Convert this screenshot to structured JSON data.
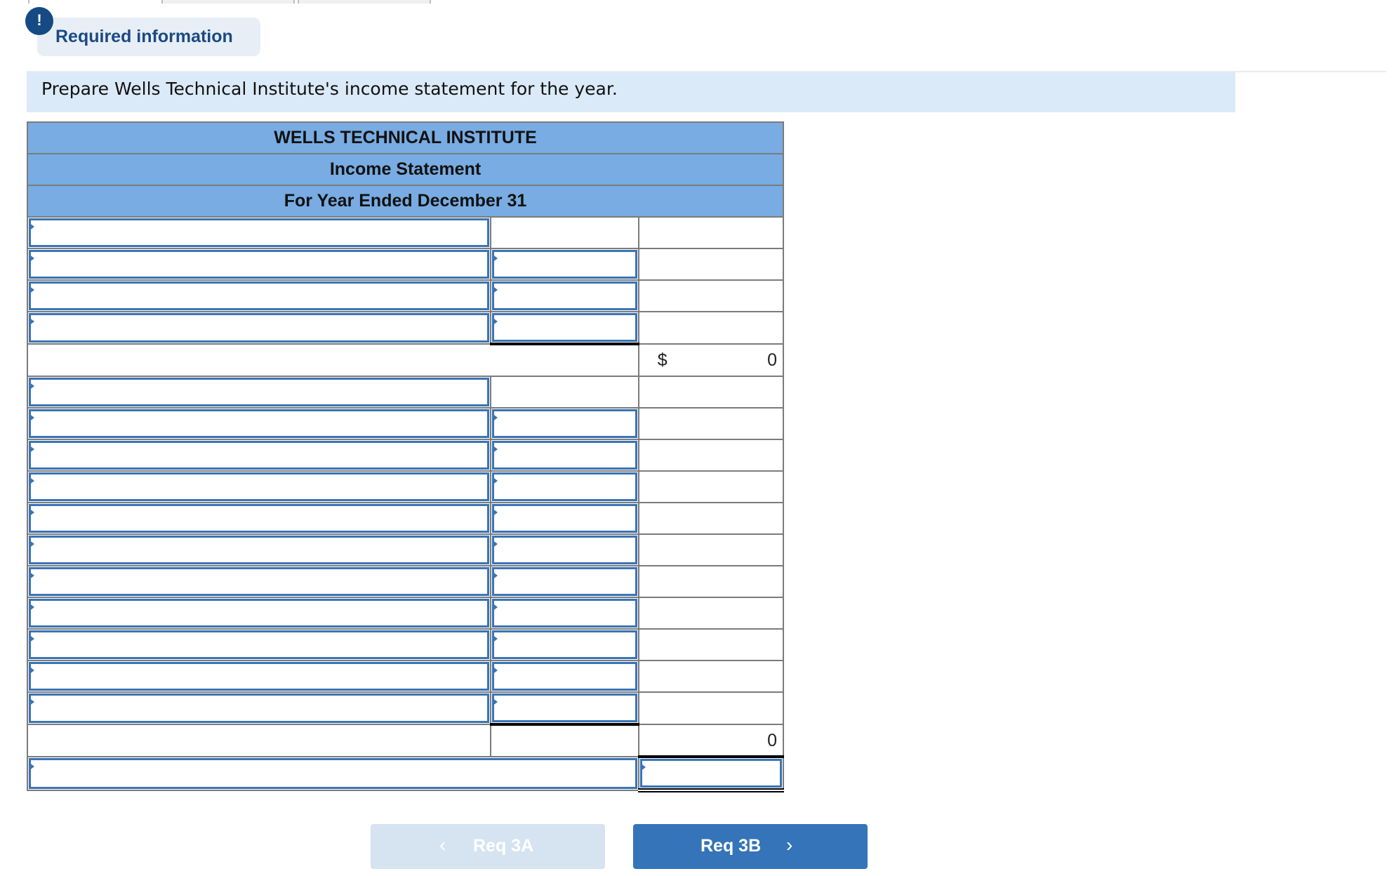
{
  "header": {
    "alert_icon": "exclamation-icon",
    "alert_glyph": "!",
    "required_label": "Required information"
  },
  "instruction": "Prepare Wells Technical Institute's income statement for the year.",
  "statement": {
    "company": "WELLS TECHNICAL INSTITUTE",
    "title": "Income Statement",
    "period": "For Year Ended December 31",
    "rows": [
      {
        "label": "",
        "amount": null,
        "total": ""
      },
      {
        "label": "",
        "amount": "",
        "total": ""
      },
      {
        "label": "",
        "amount": "",
        "total": ""
      },
      {
        "label": "",
        "amount": "",
        "total": ""
      },
      {
        "currency": "$",
        "total": "0"
      },
      {
        "label": "",
        "amount": null,
        "total": ""
      },
      {
        "label": "",
        "amount": "",
        "total": ""
      },
      {
        "label": "",
        "amount": "",
        "total": ""
      },
      {
        "label": "",
        "amount": "",
        "total": ""
      },
      {
        "label": "",
        "amount": "",
        "total": ""
      },
      {
        "label": "",
        "amount": "",
        "total": ""
      },
      {
        "label": "",
        "amount": "",
        "total": ""
      },
      {
        "label": "",
        "amount": "",
        "total": ""
      },
      {
        "label": "",
        "amount": "",
        "total": ""
      },
      {
        "label": "",
        "amount": "",
        "total": ""
      },
      {
        "label": "",
        "amount": "",
        "total": ""
      },
      {
        "total": "0"
      },
      {
        "label": "",
        "total": ""
      }
    ]
  },
  "nav": {
    "prev_label": "Req 3A",
    "prev_icon": "chevron-left-icon",
    "prev_disabled": true,
    "next_label": "Req 3B",
    "next_icon": "chevron-right-icon"
  },
  "colors": {
    "header_blue": "#78ace2",
    "instruction_band": "#dbeaf8",
    "input_border": "#3a74b5",
    "next_button": "#3574b8",
    "prev_button_disabled": "#d6e3f1",
    "badge": "#154a84"
  }
}
